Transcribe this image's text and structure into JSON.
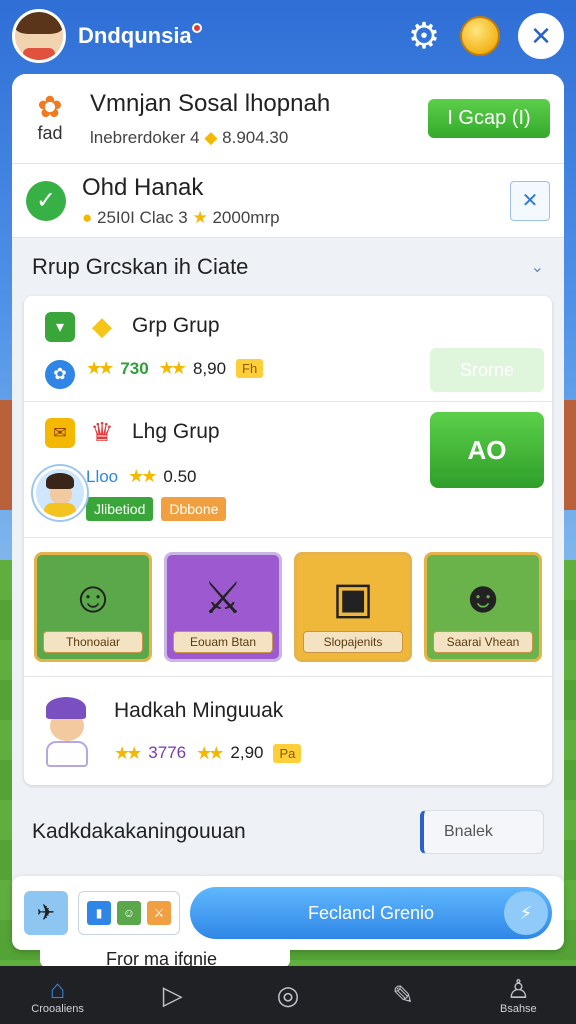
{
  "header": {
    "title": "Dndqunsia",
    "icons": [
      "avatar",
      "gear-icon",
      "coin-icon",
      "close-icon"
    ]
  },
  "top_rows": [
    {
      "title": "Vmnjan Sosal lhopnah",
      "icon_text": "fad",
      "sub_text": "lnebrerdoker 4",
      "sub_value": "8.904.30",
      "button": "I Gcap (I)"
    },
    {
      "title": "Ohd Hanak",
      "sub_text": "25I0I Clac 3",
      "sub_value": "2000mrp"
    }
  ],
  "section": {
    "title": "Rrup Grcskan ih Ciate"
  },
  "groups": [
    {
      "title": "Grp Grup",
      "stat1": "730",
      "stat2": "8,90",
      "badge": "Fh",
      "button": "Srorne"
    },
    {
      "title": "Lhg Grup",
      "stat_label": "Lloo",
      "stat2": "0.50",
      "button": "AO",
      "tag1": "Jlibetiod",
      "tag2": "Dbbone"
    }
  ],
  "tiles": [
    {
      "label": "Thonoaiar",
      "bg": "#5aa84a"
    },
    {
      "label": "Eouam Btan",
      "bg": "#9d5ad0"
    },
    {
      "label": "Slopajenits",
      "bg": "#f0b83a"
    },
    {
      "label": "Saarai Vhean",
      "bg": "#6ab34a"
    }
  ],
  "person": {
    "title": "Hadkah Minguuak",
    "stat1": "3776",
    "stat2": "2,90",
    "badge": "Pa"
  },
  "bottom_line": {
    "label": "Kadkdakakaningouuan",
    "pill": "Bnalek"
  },
  "action_bar": {
    "main": "Feclancl Grenio"
  },
  "behind_row": {
    "text": "Fror ma ifgnie"
  },
  "nav": [
    {
      "label": "Crooaliens",
      "icon": "home-icon"
    },
    {
      "label": "",
      "icon": "play-icon"
    },
    {
      "label": "",
      "icon": "record-icon"
    },
    {
      "label": "",
      "icon": "edit-icon"
    },
    {
      "label": "Bsahse",
      "icon": "profile-icon"
    }
  ],
  "colors": {
    "header_bg": "#2f6fd6",
    "accent_green": "#35a92b",
    "accent_blue": "#2f86e6",
    "nav_bg": "#1f2124"
  }
}
